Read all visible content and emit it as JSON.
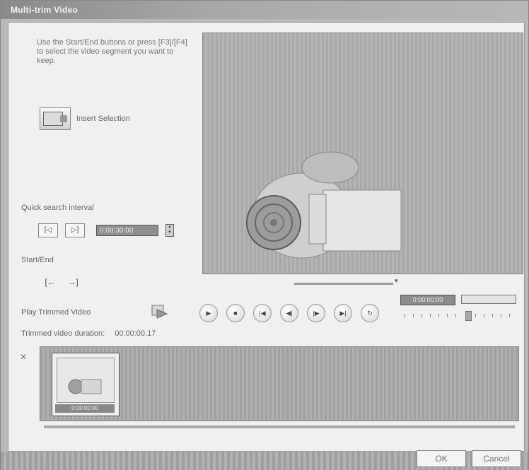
{
  "window": {
    "title": "Multi-trim Video"
  },
  "instructions": "Use the Start/End buttons or press [F3]/[F4] to select the video segment you want to keep.",
  "insert_selection": {
    "label": "Insert Selection"
  },
  "quick_search": {
    "label": "Quick search interval",
    "back_label": "[◁",
    "forward_label": "▷]",
    "value": "0:00:30:00"
  },
  "start_end": {
    "label": "Start/End",
    "start_symbol": "[←",
    "end_symbol": "→]"
  },
  "play_trimmed": {
    "label": "Play Trimmed Video"
  },
  "timecode": "0:00:00:00",
  "trimmed_duration": {
    "label": "Trimmed video duration:",
    "value": "00:00:00.17"
  },
  "thumbnail": {
    "timecode": "0:00:00:00"
  },
  "dialog": {
    "ok": "OK",
    "cancel": "Cancel"
  },
  "icons": {
    "play": "play-icon",
    "stop": "stop-icon",
    "home": "go-to-start-icon",
    "prev_frame": "previous-frame-icon",
    "next_frame": "next-frame-icon",
    "end": "go-to-end-icon",
    "repeat": "repeat-icon"
  }
}
